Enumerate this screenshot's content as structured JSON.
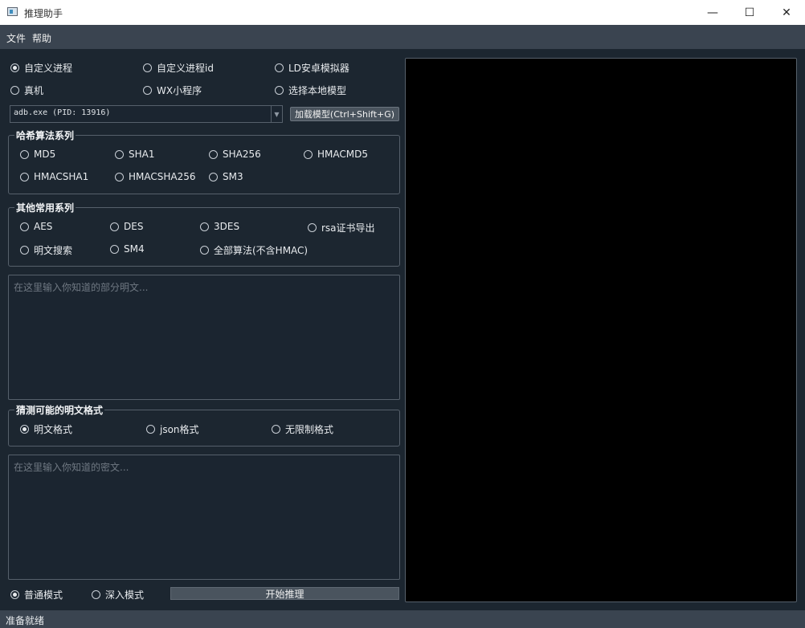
{
  "window": {
    "title": "推理助手",
    "minimize_glyph": "—",
    "maximize_glyph": "☐",
    "close_glyph": "✕"
  },
  "menu": {
    "file": "文件",
    "help": "帮助"
  },
  "source": {
    "custom_process": "自定义进程",
    "custom_process_id": "自定义进程id",
    "ld_emulator": "LD安卓模拟器",
    "real_device": "真机",
    "wx_miniprogram": "WX小程序",
    "local_model": "选择本地模型",
    "selected": "custom_process"
  },
  "process_select": {
    "value": "adb.exe (PID: 13916)"
  },
  "load_model_button": "加载模型(Ctrl+Shift+G)",
  "hash_group": {
    "title": "哈希算法系列",
    "items": [
      "MD5",
      "SHA1",
      "SHA256",
      "HMACMD5",
      "HMACSHA1",
      "HMACSHA256",
      "SM3"
    ]
  },
  "other_group": {
    "title": "其他常用系列",
    "items": [
      "AES",
      "DES",
      "3DES",
      "rsa证书导出",
      "明文搜索",
      "SM4",
      "全部算法(不含HMAC)"
    ]
  },
  "plaintext_input": {
    "placeholder": "在这里输入你知道的部分明文..."
  },
  "format_group": {
    "title": "猜测可能的明文格式",
    "items": [
      "明文格式",
      "json格式",
      "无限制格式"
    ],
    "selected": "明文格式"
  },
  "ciphertext_input": {
    "placeholder": "在这里输入你知道的密文..."
  },
  "mode": {
    "normal": "普通模式",
    "deep": "深入模式",
    "selected": "普通模式"
  },
  "start_button": "开始推理",
  "status": "准备就绪",
  "colors": {
    "background": "#1c2630",
    "bar": "#3a4450",
    "border": "#56606b",
    "output": "#000000"
  }
}
